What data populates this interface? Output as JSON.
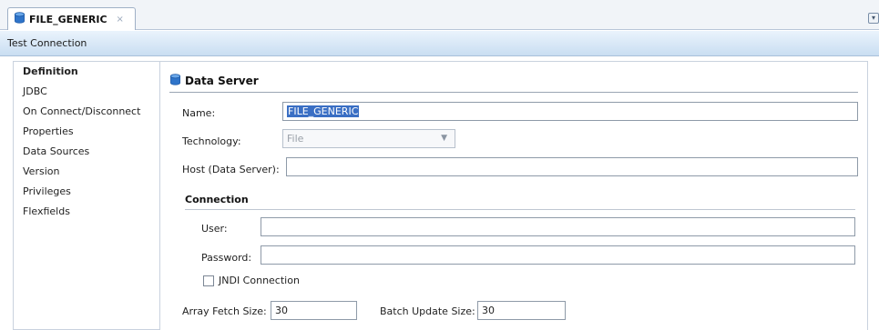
{
  "tab": {
    "title": "FILE_GENERIC",
    "close_glyph": "×"
  },
  "menu_button_glyph": "▾",
  "toolbar": {
    "test_connection_label": "Test Connection"
  },
  "nav": {
    "items": [
      {
        "label": "Definition",
        "selected": true
      },
      {
        "label": "JDBC",
        "selected": false
      },
      {
        "label": "On Connect/Disconnect",
        "selected": false
      },
      {
        "label": "Properties",
        "selected": false
      },
      {
        "label": "Data Sources",
        "selected": false
      },
      {
        "label": "Version",
        "selected": false
      },
      {
        "label": "Privileges",
        "selected": false
      },
      {
        "label": "Flexfields",
        "selected": false
      }
    ]
  },
  "data_server": {
    "title": "Data Server",
    "name_label": "Name:",
    "name_value": "FILE_GENERIC",
    "technology_label": "Technology:",
    "technology_value": "File",
    "host_label": "Host (Data Server):",
    "host_value": ""
  },
  "connection": {
    "title": "Connection",
    "user_label": "User:",
    "user_value": "",
    "password_label": "Password:",
    "password_value": "",
    "jndi_label": "JNDI Connection",
    "jndi_checked": false
  },
  "sizes": {
    "array_fetch_label": "Array Fetch Size:",
    "array_fetch_value": "30",
    "batch_update_label": "Batch Update Size:",
    "batch_update_value": "30"
  },
  "icons": {
    "tab_icon": "database-icon",
    "section_icon": "database-icon"
  },
  "colors": {
    "toolbar_top": "#eaf3fc",
    "toolbar_bottom": "#c9def2",
    "selection": "#3a6fc4"
  }
}
